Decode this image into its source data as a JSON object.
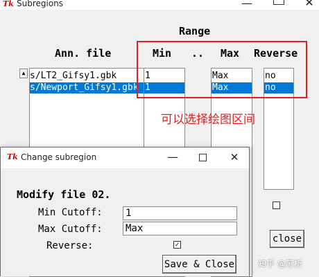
{
  "main": {
    "title": "Subregions",
    "app_icon": "Tk",
    "range_header": "Range",
    "columns": {
      "ann_file": "Ann. file",
      "min": "Min",
      "sep": "..",
      "max": "Max",
      "reverse": "Reverse"
    },
    "rows": [
      {
        "file": "s/LT2_Gifsy1.gbk",
        "min": "1",
        "max": "Max",
        "reverse": "no",
        "selected": false
      },
      {
        "file": "s/Newport_Gifsy1.gbk",
        "min": "1",
        "max": "Max",
        "reverse": "no",
        "selected": true
      }
    ],
    "close_label": "close",
    "reverse_checkbox_checked": false
  },
  "annotation": {
    "text": "可以选择绘图区间",
    "color": "#e02020"
  },
  "dialog": {
    "title": "Change subregion",
    "app_icon": "Tk",
    "heading": "Modify file 02.",
    "min_label": "Min Cutoff:",
    "min_value": "1",
    "max_label": "Max Cutoff:",
    "max_value": "Max",
    "reverse_label": "Reverse:",
    "reverse_checked": true,
    "save_label": "Save & Close"
  },
  "watermark": "知乎 @苏析",
  "colors": {
    "selection": "#0078d7",
    "highlight_box": "#e02020"
  }
}
